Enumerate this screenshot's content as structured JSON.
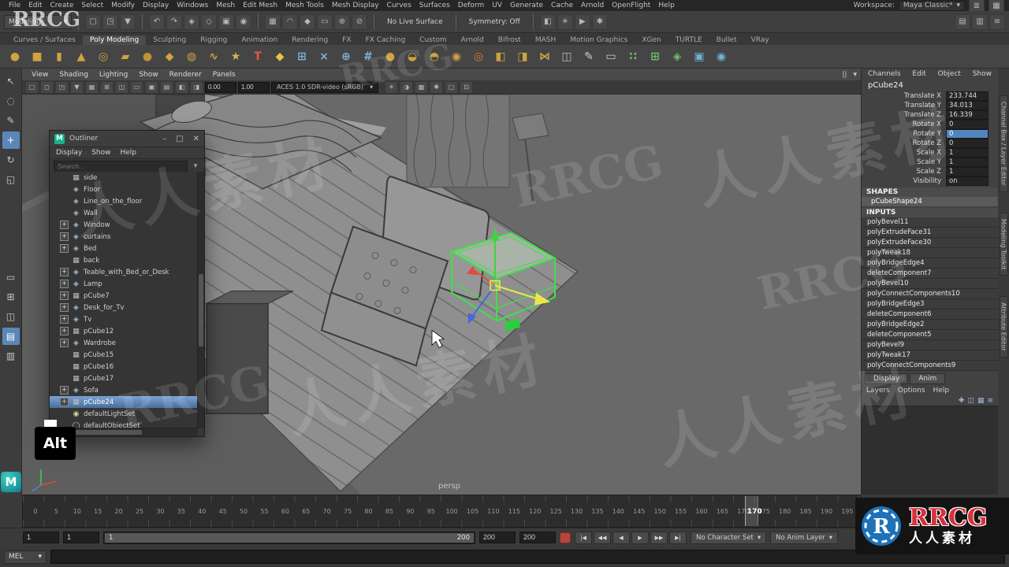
{
  "menubar": {
    "items": [
      "File",
      "Edit",
      "Create",
      "Select",
      "Modify",
      "Display",
      "Windows",
      "Mesh",
      "Edit Mesh",
      "Mesh Tools",
      "Mesh Display",
      "Curves",
      "Surfaces",
      "Deform",
      "UV",
      "Generate",
      "Cache",
      "Arnold",
      "OpenFlight",
      "Help"
    ],
    "workspace_label": "Workspace:",
    "workspace_value": "Maya Classic*"
  },
  "statusline": {
    "mode": "Modeling",
    "live_surface": "No Live Surface",
    "symmetry": "Symmetry: Off",
    "icons_a": [
      {
        "name": "new-scene-icon",
        "glyph": "▢"
      },
      {
        "name": "open-scene-icon",
        "glyph": "◳"
      },
      {
        "name": "save-scene-icon",
        "glyph": "▼"
      }
    ],
    "icons_b": [
      {
        "name": "undo-icon",
        "glyph": "↶"
      },
      {
        "name": "redo-icon",
        "glyph": "↷"
      },
      {
        "name": "select-hierarchy-icon",
        "glyph": "◈"
      },
      {
        "name": "select-object-icon",
        "glyph": "◇"
      },
      {
        "name": "select-component-icon",
        "glyph": "▣"
      },
      {
        "name": "highlight-selection-icon",
        "glyph": "◉"
      }
    ],
    "icons_c": [
      {
        "name": "snap-grid-icon",
        "glyph": "▦"
      },
      {
        "name": "snap-curve-icon",
        "glyph": "◠"
      },
      {
        "name": "snap-point-icon",
        "glyph": "◆"
      },
      {
        "name": "snap-plane-icon",
        "glyph": "▭"
      },
      {
        "name": "make-live-icon",
        "glyph": "⊕"
      },
      {
        "name": "snap-off-icon",
        "glyph": "⊘"
      }
    ],
    "icons_d": [
      {
        "name": "construction-history-icon",
        "glyph": "◧"
      },
      {
        "name": "render-icon",
        "glyph": "☀"
      },
      {
        "name": "ipr-render-icon",
        "glyph": "▶"
      },
      {
        "name": "render-settings-icon",
        "glyph": "✱"
      }
    ],
    "icons_r": [
      {
        "name": "sidebar-toggle-icon",
        "glyph": "▤"
      },
      {
        "name": "panel-toggle-icon",
        "glyph": "▥"
      },
      {
        "name": "menu-toggle-icon",
        "glyph": "≡"
      }
    ]
  },
  "shelf": {
    "tabs": [
      {
        "label": "Curves / Surfaces"
      },
      {
        "label": "Poly Modeling",
        "active": true
      },
      {
        "label": "Sculpting"
      },
      {
        "label": "Rigging"
      },
      {
        "label": "Animation"
      },
      {
        "label": "Rendering"
      },
      {
        "label": "FX"
      },
      {
        "label": "FX Caching"
      },
      {
        "label": "Custom"
      },
      {
        "label": "Arnold"
      },
      {
        "label": "Bifrost"
      },
      {
        "label": "MASH"
      },
      {
        "label": "Motion Graphics"
      },
      {
        "label": "XGen"
      },
      {
        "label": "TURTLE"
      },
      {
        "label": "Bullet"
      },
      {
        "label": "VRay"
      }
    ],
    "icons": [
      {
        "name": "poly-sphere-icon",
        "glyph": "●",
        "color": "#cfa33e"
      },
      {
        "name": "poly-cube-icon",
        "glyph": "■",
        "color": "#cfa33e"
      },
      {
        "name": "poly-cylinder-icon",
        "glyph": "▮",
        "color": "#cfa33e"
      },
      {
        "name": "poly-cone-icon",
        "glyph": "▲",
        "color": "#cfa33e"
      },
      {
        "name": "poly-torus-icon",
        "glyph": "◎",
        "color": "#cfa33e"
      },
      {
        "name": "poly-plane-icon",
        "glyph": "▰",
        "color": "#cfa33e"
      },
      {
        "name": "poly-disc-icon",
        "glyph": "●",
        "color": "#c09238"
      },
      {
        "name": "platonic-solid-icon",
        "glyph": "◆",
        "color": "#cfa33e"
      },
      {
        "name": "poly-pipe-icon",
        "glyph": "◍",
        "color": "#cfa33e"
      },
      {
        "name": "poly-helix-icon",
        "glyph": "∿",
        "color": "#cfa33e"
      },
      {
        "name": "sculpt-tool-icon",
        "glyph": "★",
        "color": "#d8b24a"
      },
      {
        "name": "type-tool-icon",
        "glyph": "T",
        "color": "#e2593b"
      },
      {
        "name": "svg-tool-icon",
        "glyph": "◆",
        "color": "#e8c53e"
      },
      {
        "name": "quad-draw-icon",
        "glyph": "⊞",
        "color": "#7fb2d8"
      },
      {
        "name": "multi-cut-icon",
        "glyph": "×",
        "color": "#7fb2d8"
      },
      {
        "name": "target-weld-icon",
        "glyph": "⊕",
        "color": "#7fb2d8"
      },
      {
        "name": "connect-icon",
        "glyph": "#",
        "color": "#7fb2d8"
      },
      {
        "name": "smooth-icon",
        "glyph": "●",
        "color": "#cfa33e"
      },
      {
        "name": "combine-icon",
        "glyph": "◒",
        "color": "#cfa33e"
      },
      {
        "name": "separate-icon",
        "glyph": "◓",
        "color": "#cfa33e"
      },
      {
        "name": "boolean-union-icon",
        "glyph": "◉",
        "color": "#cfa33e"
      },
      {
        "name": "boolean-difference-icon",
        "glyph": "◎",
        "color": "#d87a3a"
      },
      {
        "name": "extrude-icon",
        "glyph": "◧",
        "color": "#cfa33e"
      },
      {
        "name": "bevel-icon",
        "glyph": "◨",
        "color": "#cfa33e"
      },
      {
        "name": "bridge-icon",
        "glyph": "⋈",
        "color": "#cfa33e"
      },
      {
        "name": "mirror-icon",
        "glyph": "◫",
        "color": "#b8b8b8"
      },
      {
        "name": "pencil-icon",
        "glyph": "✎",
        "color": "#cccccc"
      },
      {
        "name": "measure-icon",
        "glyph": "▭",
        "color": "#cccccc"
      },
      {
        "name": "mash-distribute-icon",
        "glyph": "∷",
        "color": "#6fc06f"
      },
      {
        "name": "mash-grid-icon",
        "glyph": "⊞",
        "color": "#6fc06f"
      },
      {
        "name": "mash-network-icon",
        "glyph": "◈",
        "color": "#6fc06f"
      },
      {
        "name": "bullet-box-icon",
        "glyph": "▣",
        "color": "#6fb3d8"
      },
      {
        "name": "bullet-sphere-icon",
        "glyph": "◉",
        "color": "#6fb3d8"
      }
    ]
  },
  "lefttool": {
    "tools": [
      {
        "name": "select-tool-icon",
        "glyph": "↖"
      },
      {
        "name": "lasso-tool-icon",
        "glyph": "◌"
      },
      {
        "name": "paint-select-tool-icon",
        "glyph": "✎"
      },
      {
        "name": "move-tool-icon",
        "glyph": "+",
        "active": true
      },
      {
        "name": "rotate-tool-icon",
        "glyph": "↻"
      },
      {
        "name": "scale-tool-icon",
        "glyph": "◱"
      }
    ],
    "layouts": [
      {
        "name": "layout-single-pane-icon",
        "glyph": "▭"
      },
      {
        "name": "layout-four-pane-icon",
        "glyph": "⊞"
      },
      {
        "name": "layout-two-pane-icon",
        "glyph": "◫"
      },
      {
        "name": "layout-outliner-persp-icon",
        "glyph": "▤",
        "active": true
      },
      {
        "name": "layout-hypershade-icon",
        "glyph": "▥"
      }
    ]
  },
  "viewport": {
    "menu": [
      "View",
      "Shading",
      "Lighting",
      "Show",
      "Renderer",
      "Panels"
    ],
    "menu_right": [
      {
        "name": "pause-icon",
        "glyph": "||"
      },
      {
        "name": "pin-icon",
        "glyph": "▾"
      }
    ],
    "bar_left": [
      {
        "name": "select-camera-icon",
        "glyph": "▢"
      },
      {
        "name": "camera-lock-icon",
        "glyph": "◻"
      },
      {
        "name": "camera-attrs-icon",
        "glyph": "◳"
      },
      {
        "name": "bookmark-icon",
        "glyph": "▼"
      },
      {
        "name": "image-plane-icon",
        "glyph": "▦"
      },
      {
        "name": "view-grid-icon",
        "glyph": "⊞"
      },
      {
        "name": "film-gate-icon",
        "glyph": "◫"
      },
      {
        "name": "resolution-gate-icon",
        "glyph": "▭"
      },
      {
        "name": "gate-mask-icon",
        "glyph": "▣"
      },
      {
        "name": "field-chart-icon",
        "glyph": "▤"
      },
      {
        "name": "safe-action-icon",
        "glyph": "◧"
      },
      {
        "name": "safe-title-icon",
        "glyph": "◨"
      }
    ],
    "exposure": "0.00",
    "gamma": "1.00",
    "colorspace": "ACES 1.0 SDR-video (sRGB)",
    "bar_right": [
      {
        "name": "lighting-all-icon",
        "glyph": "☀"
      },
      {
        "name": "shadows-icon",
        "glyph": "◑"
      },
      {
        "name": "ao-icon",
        "glyph": "▩"
      },
      {
        "name": "antialias-icon",
        "glyph": "✱"
      },
      {
        "name": "xray-icon",
        "glyph": "▢"
      },
      {
        "name": "isolate-select-icon",
        "glyph": "⊡"
      }
    ],
    "camera_label": "persp"
  },
  "outliner": {
    "title": "Outliner",
    "window_buttons": {
      "minimize": "–",
      "maximize": "□",
      "close": "✕"
    },
    "menu": [
      "Display",
      "Show",
      "Help"
    ],
    "search_placeholder": "Search...",
    "items": [
      {
        "label": "side",
        "icon": "mesh"
      },
      {
        "label": "Floor",
        "icon": "transform"
      },
      {
        "label": "Line_on_the_floor",
        "icon": "transform"
      },
      {
        "label": "Wall",
        "icon": "transform"
      },
      {
        "label": "Window",
        "icon": "transform",
        "expandable": true
      },
      {
        "label": "curtains",
        "icon": "transform",
        "expandable": true
      },
      {
        "label": "Bed",
        "icon": "transform",
        "expandable": true
      },
      {
        "label": "back",
        "icon": "mesh"
      },
      {
        "label": "Teable_with_Bed_or_Desk",
        "icon": "transform",
        "expandable": true
      },
      {
        "label": "Lamp",
        "icon": "transform",
        "expandable": true
      },
      {
        "label": "pCube7",
        "icon": "mesh",
        "expandable": true
      },
      {
        "label": "Desk_for_Tv",
        "icon": "transform",
        "expandable": true
      },
      {
        "label": "Tv",
        "icon": "transform",
        "expandable": true
      },
      {
        "label": "pCube12",
        "icon": "mesh",
        "expandable": true
      },
      {
        "label": "Wardrobe",
        "icon": "transform",
        "expandable": true
      },
      {
        "label": "pCube15",
        "icon": "mesh"
      },
      {
        "label": "pCube16",
        "icon": "mesh"
      },
      {
        "label": "pCube17",
        "icon": "mesh"
      },
      {
        "label": "Sofa",
        "icon": "transform",
        "expandable": true
      },
      {
        "label": "pCube24",
        "icon": "mesh",
        "expandable": true,
        "selected": true
      },
      {
        "label": "defaultLightSet",
        "icon": "light"
      },
      {
        "label": "defaultObjectSet",
        "icon": "set"
      }
    ]
  },
  "channelbox": {
    "menu": [
      "Channels",
      "Edit",
      "Object",
      "Show"
    ],
    "object_name": "pCube24",
    "channels": [
      {
        "name": "Translate X",
        "value": "233.744"
      },
      {
        "name": "Translate Y",
        "value": "34.013"
      },
      {
        "name": "Translate Z",
        "value": "16.339"
      },
      {
        "name": "Rotate X",
        "value": "0"
      },
      {
        "name": "Rotate Y",
        "value": "0",
        "hl": true
      },
      {
        "name": "Rotate Z",
        "value": "0"
      },
      {
        "name": "Scale X",
        "value": "1"
      },
      {
        "name": "Scale Y",
        "value": "1"
      },
      {
        "name": "Scale Z",
        "value": "1"
      },
      {
        "name": "Visibility",
        "value": "on"
      }
    ],
    "shapes_header": "SHAPES",
    "shape_name": "pCubeShape24",
    "inputs_header": "INPUTS",
    "inputs": [
      "polyBevel11",
      "polyExtrudeFace31",
      "polyExtrudeFace30",
      "polyTweak18",
      "polyBridgeEdge4",
      "deleteComponent7",
      "polyBevel10",
      "polyConnectComponents10",
      "polyBridgeEdge3",
      "deleteComponent6",
      "polyBridgeEdge2",
      "deleteComponent5",
      "polyBevel9",
      "polyTweak17",
      "polyConnectComponents9"
    ],
    "bottom_tabs": [
      "Display",
      "Anim"
    ],
    "layer_menu": [
      "Layers",
      "Options",
      "Help"
    ],
    "layer_icons": [
      {
        "name": "layer-new-icon",
        "glyph": "✚"
      },
      {
        "name": "layer-empty-icon",
        "glyph": "◫"
      },
      {
        "name": "layer-selected-icon",
        "glyph": "▦"
      },
      {
        "name": "layer-list-icon",
        "glyph": "≡"
      }
    ]
  },
  "side_tabs": [
    "Channel Box / Layer Editor",
    "Modeling Toolkit",
    "Attribute Editor"
  ],
  "timeline": {
    "ticks": [
      "0",
      "5",
      "10",
      "15",
      "20",
      "25",
      "30",
      "35",
      "40",
      "45",
      "50",
      "55",
      "60",
      "65",
      "70",
      "75",
      "80",
      "85",
      "90",
      "95",
      "100",
      "105",
      "110",
      "115",
      "120",
      "125",
      "130",
      "135",
      "140",
      "145",
      "150",
      "155",
      "160",
      "165",
      "170",
      "175",
      "180",
      "185",
      "190",
      "195"
    ],
    "current_frame": "170"
  },
  "rangebar": {
    "playback_start": "1",
    "anim_start": "1",
    "range_start": "1",
    "range_end": "200",
    "anim_end": "200",
    "playback_end": "200",
    "playback": [
      "|◀",
      "◀◀",
      "◀",
      "▶",
      "▶▶",
      "▶|"
    ],
    "character_set": "No Character Set",
    "anim_layer": "No Anim Layer"
  },
  "cmdline": {
    "label": "MEL"
  },
  "overlays": {
    "alt_key": "Alt"
  },
  "watermark": {
    "cn": "人人素材",
    "en": "RRCG",
    "brand": "RRCG",
    "brand_sub": "人人素材"
  },
  "colors": {
    "selection_blue": "#5285bd",
    "selected_object_green": "#3fe04a",
    "axis_red": "#e04b3f",
    "axis_green": "#3fd43f",
    "axis_blue": "#4466e0",
    "axis_yellow": "#e8e84a",
    "brand_red": "#d8303a",
    "brand_blue": "#1e72b8"
  }
}
